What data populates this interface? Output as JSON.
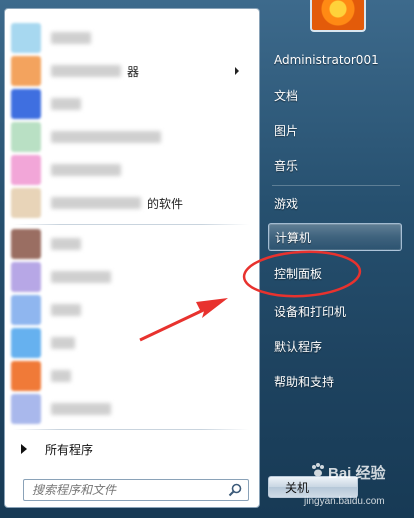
{
  "programs": {
    "items": [
      {
        "label": "",
        "icon_color": "#a7d8f0",
        "label_w": 40
      },
      {
        "label": "器",
        "icon_color": "#f3a35e",
        "label_w": 70,
        "has_submenu": true
      },
      {
        "label": "",
        "icon_color": "#3f6fe0",
        "label_w": 30
      },
      {
        "label": "",
        "icon_color": "#b9e0c4",
        "label_w": 110
      },
      {
        "label": "",
        "icon_color": "#f2a6d8",
        "label_w": 70
      },
      {
        "label": "的软件",
        "icon_color": "#e8d4b8",
        "label_w": 90
      },
      {
        "label": "",
        "icon_color": "#9a6e62",
        "label_w": 30
      },
      {
        "label": "",
        "icon_color": "#b7a7e6",
        "label_w": 60
      },
      {
        "label": "",
        "icon_color": "#8fb6ef",
        "label_w": 30
      },
      {
        "label": "",
        "icon_color": "#66b1ef",
        "label_w": 24
      },
      {
        "label": "",
        "icon_color": "#f07a38",
        "label_w": 20
      },
      {
        "label": "",
        "icon_color": "#a9b8ec",
        "label_w": 60
      }
    ]
  },
  "all_programs_label": "所有程序",
  "search": {
    "placeholder": "搜索程序和文件"
  },
  "right_menu": {
    "user_name": "Administrator001",
    "documents": "文档",
    "pictures": "图片",
    "music": "音乐",
    "games": "游戏",
    "computer": "计算机",
    "control_panel": "控制面板",
    "devices_printers": "设备和打印机",
    "default_programs": "默认程序",
    "help_support": "帮助和支持"
  },
  "shutdown_label": "关机",
  "watermark": {
    "logo": "Bai 经验",
    "url": "jingyan.baidu.com"
  },
  "colors": {
    "annotation_red": "#e8322e",
    "menu_bg": "#1e4360",
    "highlight_border": "#c8dcf0"
  }
}
